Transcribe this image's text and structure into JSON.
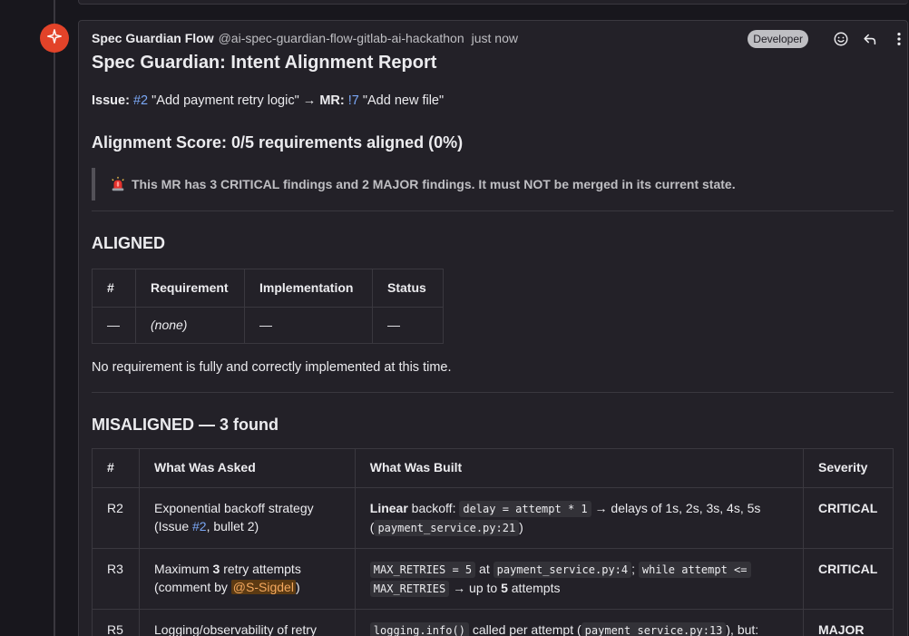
{
  "note": {
    "author": "Spec Guardian Flow",
    "handle": "@ai-spec-guardian-flow-gitlab-ai-hackathon",
    "time": "just now",
    "role": "Developer"
  },
  "report": {
    "title": "Spec Guardian: Intent Alignment Report",
    "issue_label": "Issue:",
    "issue_ref": "#2",
    "issue_title": "\"Add payment retry logic\"",
    "arrow": "→",
    "mr_label": "MR:",
    "mr_ref": "!7",
    "mr_title": "\"Add new file\"",
    "score": "Alignment Score: 0/5 requirements aligned (0%)",
    "warning": "This MR has 3 CRITICAL findings and 2 MAJOR findings. It must NOT be merged in its current state."
  },
  "aligned": {
    "heading": "ALIGNED",
    "columns": [
      "#",
      "Requirement",
      "Implementation",
      "Status"
    ],
    "row": [
      "—",
      "(none)",
      "—",
      "—"
    ],
    "note": "No requirement is fully and correctly implemented at this time."
  },
  "misaligned": {
    "heading": "MISALIGNED — 3 found",
    "columns": [
      "#",
      "What Was Asked",
      "What Was Built",
      "Severity"
    ],
    "rows": [
      {
        "id": "R2",
        "asked_a": "Exponential backoff strategy",
        "asked_b": "(Issue ",
        "asked_ref": "#2",
        "asked_c": ", bullet 2)",
        "built_bold": "Linear",
        "built_a": " backoff: ",
        "built_code1": "delay = attempt * 1",
        "built_b": " → delays of 1s, 2s, 3s, 4s, 5s",
        "built_c": "(",
        "built_code2": "payment_service.py:21",
        "built_d": ")",
        "severity": "CRITICAL"
      },
      {
        "id": "R3",
        "asked_a": "Maximum ",
        "asked_bold": "3",
        "asked_b": " retry attempts",
        "asked_c": "(comment by ",
        "asked_mention": "@S-Sigdel",
        "asked_d": ")",
        "built_code1": "MAX_RETRIES = 5",
        "built_a": " at ",
        "built_code2": "payment_service.py:4",
        "built_b": "; ",
        "built_code3": "while attempt <=",
        "built_code4": "MAX_RETRIES",
        "built_c": " → up to ",
        "built_bold": "5",
        "built_d": " attempts",
        "severity": "CRITICAL"
      },
      {
        "id": "R5",
        "asked_a": "Logging/observability of retry",
        "built_code1": "logging.info()",
        "built_a": " called per attempt (",
        "built_code2": "payment_service.py:13",
        "built_b": "), but:",
        "severity": "MAJOR"
      }
    ]
  },
  "colors": {
    "background": "#18171d",
    "card": "#232128",
    "border": "#3a383f",
    "link": "#7aa7f5",
    "avatar": "#e24329",
    "mention_bg": "#5c3a12",
    "mention_fg": "#f5a95f"
  },
  "icons": {
    "avatar": "sparkle-icon",
    "emoji": "smiley-icon",
    "reply": "reply-icon",
    "more": "kebab-menu-icon",
    "warning": "siren-icon"
  }
}
